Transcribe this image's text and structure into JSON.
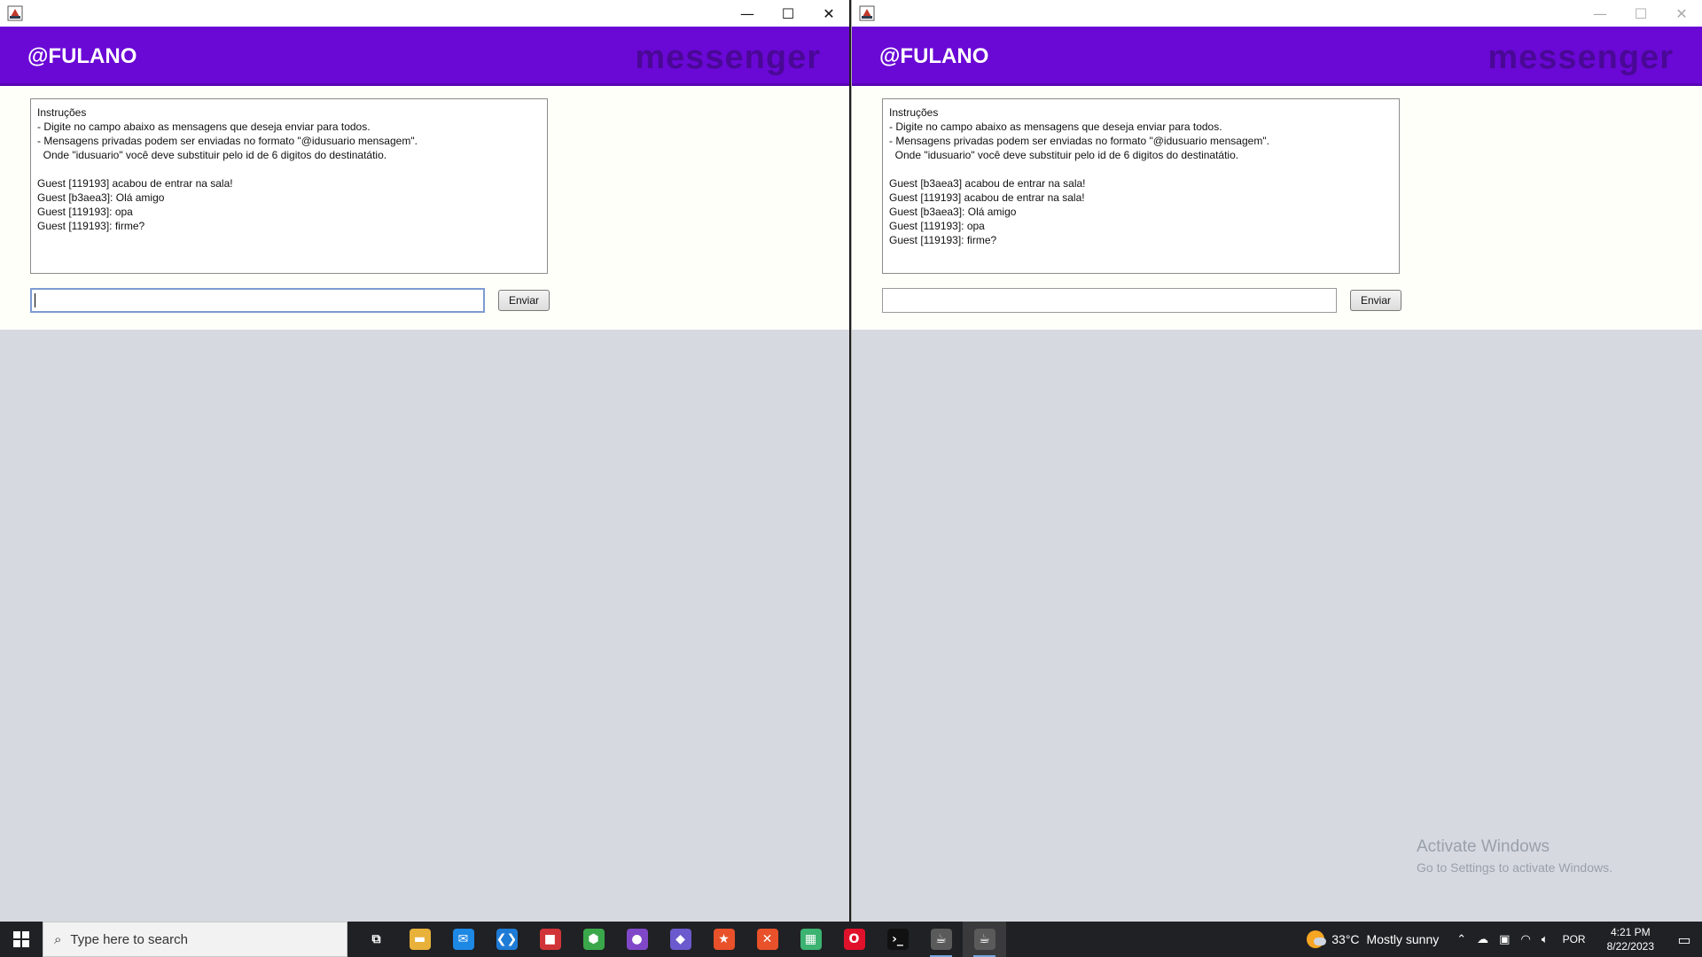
{
  "windows": [
    {
      "header": {
        "user": "@FULANO",
        "brand": "messenger"
      },
      "chat_lines": [
        "Instruções",
        "- Digite no campo abaixo as mensagens que deseja enviar para todos.",
        "- Mensagens privadas podem ser enviadas no formato \"@idusuario mensagem\".",
        "  Onde \"idusuario\" você deve substituir pelo id de 6 digitos do destinatátio.",
        "",
        "Guest [119193] acabou de entrar na sala!",
        "Guest [b3aea3]: Olá amigo",
        "Guest [119193]: opa",
        "Guest [119193]: firme?"
      ],
      "input_value": "",
      "send_label": "Enviar"
    },
    {
      "header": {
        "user": "@FULANO",
        "brand": "messenger"
      },
      "chat_lines": [
        "Instruções",
        "- Digite no campo abaixo as mensagens que deseja enviar para todos.",
        "- Mensagens privadas podem ser enviadas no formato \"@idusuario mensagem\".",
        "  Onde \"idusuario\" você deve substituir pelo id de 6 digitos do destinatátio.",
        "",
        "Guest [b3aea3] acabou de entrar na sala!",
        "Guest [119193] acabou de entrar na sala!",
        "Guest [b3aea3]: Olá amigo",
        "Guest [119193]: opa",
        "Guest [119193]: firme?"
      ],
      "input_value": "",
      "send_label": "Enviar"
    }
  ],
  "watermark": {
    "title": "Activate Windows",
    "subtitle": "Go to Settings to activate Windows."
  },
  "taskbar": {
    "search_placeholder": "Type here to search",
    "apps": [
      {
        "name": "task-view-icon",
        "glyph": "⧉",
        "color": "#202124"
      },
      {
        "name": "file-explorer-icon",
        "glyph": "▬",
        "color": "#e8b13a"
      },
      {
        "name": "mail-icon",
        "glyph": "✉",
        "color": "#1e88e5"
      },
      {
        "name": "vscode-icon",
        "glyph": "❮❯",
        "color": "#1e7bd6"
      },
      {
        "name": "office-icon",
        "glyph": "■",
        "color": "#d13438"
      },
      {
        "name": "cube-app-icon",
        "glyph": "⬢",
        "color": "#3aa84a"
      },
      {
        "name": "github-desktop-icon",
        "glyph": "●",
        "color": "#8048c8"
      },
      {
        "name": "git-icon",
        "glyph": "◆",
        "color": "#6a5acd"
      },
      {
        "name": "star-app-icon",
        "glyph": "★",
        "color": "#e8512a"
      },
      {
        "name": "xampp-icon",
        "glyph": "✕",
        "color": "#e8512a"
      },
      {
        "name": "color-app-icon",
        "glyph": "▦",
        "color": "#3cb371"
      },
      {
        "name": "opera-icon",
        "glyph": "O",
        "color": "#e0112b"
      },
      {
        "name": "terminal-icon",
        "glyph": "›_",
        "color": "#111111"
      },
      {
        "name": "java-app-icon-1",
        "glyph": "☕",
        "color": "#5a5a5a"
      },
      {
        "name": "java-app-icon-2",
        "glyph": "☕",
        "color": "#5a5a5a"
      }
    ],
    "weather_temp": "33°C",
    "weather_text": "Mostly sunny",
    "language": "POR",
    "time": "4:21 PM",
    "date": "8/22/2023"
  }
}
